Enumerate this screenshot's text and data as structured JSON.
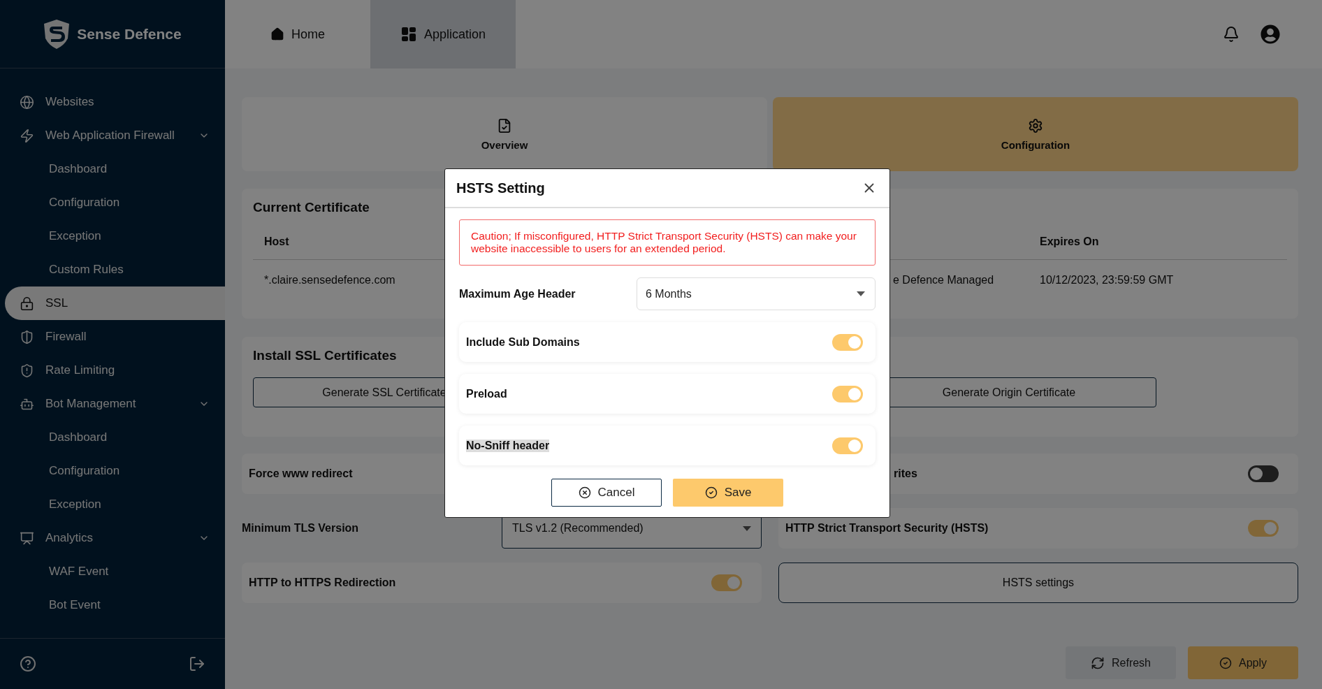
{
  "sidebar": {
    "brand": "Sense Defence",
    "items": [
      {
        "label": "Websites",
        "selected": false
      },
      {
        "label": "Web Application Firewall",
        "selected": false,
        "expanded": true,
        "children": [
          {
            "label": "Dashboard",
            "selected": false
          },
          {
            "label": "Configuration",
            "selected": false
          },
          {
            "label": "Exception",
            "selected": false
          },
          {
            "label": "Custom Rules",
            "selected": false
          }
        ]
      },
      {
        "label": "SSL",
        "selected": true
      },
      {
        "label": "Firewall",
        "selected": false
      },
      {
        "label": "Rate Limiting",
        "selected": false
      },
      {
        "label": "Bot Management",
        "selected": false,
        "expanded": true,
        "children": [
          {
            "label": "Dashboard",
            "selected": false
          },
          {
            "label": "Configuration",
            "selected": false
          },
          {
            "label": "Exception",
            "selected": false
          }
        ]
      },
      {
        "label": "Analytics",
        "selected": false,
        "expanded": true,
        "children": [
          {
            "label": "WAF Event",
            "selected": false
          },
          {
            "label": "Bot Event",
            "selected": false
          }
        ]
      }
    ]
  },
  "header": {
    "tabs": [
      {
        "label": "Home",
        "selected": false
      },
      {
        "label": "Application",
        "selected": true
      }
    ]
  },
  "section_tabs": [
    {
      "label": "Overview",
      "selected": false
    },
    {
      "label": "Configuration",
      "selected": true
    }
  ],
  "current_certificate": {
    "title": "Current Certificate",
    "columns": [
      {
        "heading": "Host"
      },
      {},
      {
        "heading": "Expires On"
      }
    ],
    "rows": [
      [
        "*.claire.sensedefence.com",
        "e Defence Managed",
        "10/12/2023, 23:59:59 GMT"
      ]
    ]
  },
  "install": {
    "title": "Install SSL Certificates",
    "buttons": [
      "Generate SSL Certificate",
      "Generate Origin Certificate"
    ]
  },
  "force_www": {
    "label": "Force www redirect"
  },
  "rewrites": {
    "label": "rites",
    "on": false
  },
  "min_tls": {
    "label": "Minimum TLS Version",
    "value": "TLS v1.2 (Recommended)"
  },
  "hsts": {
    "label": "HTTP Strict Transport Security (HSTS)",
    "on": true
  },
  "https_redirect": {
    "label": "HTTP to HTTPS Redirection",
    "on": true
  },
  "hsts_settings_button": "HSTS settings",
  "actions": [
    "Refresh",
    "Apply"
  ],
  "modal": {
    "title": "HSTS Setting",
    "caution": "Caution; If misconfigured, HTTP Strict Transport Security (HSTS) can make your website inaccessible to users for an extended period.",
    "max_age": {
      "label": "Maximum Age Header",
      "value": "6 Months"
    },
    "toggles": [
      {
        "label": "Include Sub Domains",
        "on": true,
        "highlighted": false
      },
      {
        "label": "Preload",
        "on": true,
        "highlighted": false
      },
      {
        "label": "No-Sniff header",
        "on": true,
        "highlighted": true
      }
    ],
    "buttons": [
      "Cancel",
      "Save"
    ]
  }
}
